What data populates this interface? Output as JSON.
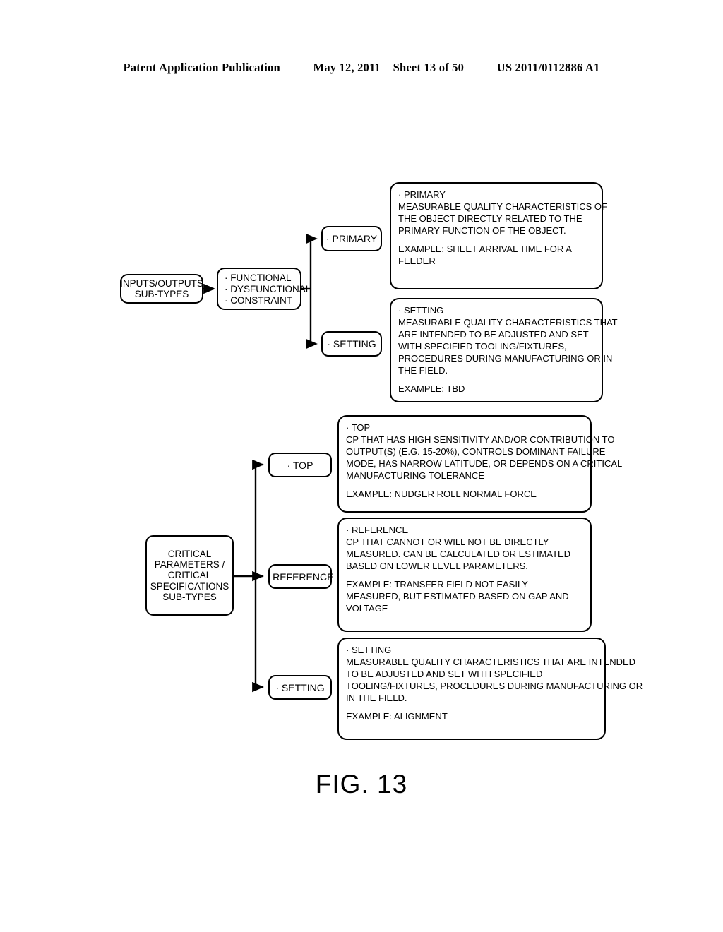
{
  "header": {
    "publication": "Patent Application Publication",
    "date": "May 12, 2011",
    "sheet": "Sheet 13 of 50",
    "number": "US 2011/0112886 A1"
  },
  "figure": {
    "caption": "FIG. 13",
    "ink_color": "#000000",
    "background_color": "#ffffff"
  },
  "diagram": {
    "branch_a": {
      "root_label": "INPUTS/OUTPUTS\nSUB-TYPES",
      "subtype_bullets": [
        "· FUNCTIONAL",
        "· DYSFUNCTIONAL",
        "· CONSTRAINT"
      ],
      "nodes": [
        {
          "pill": "· PRIMARY",
          "description": [
            "· PRIMARY",
            " MEASURABLE QUALITY CHARACTERISTICS OF",
            "THE OBJECT DIRECTLY RELATED TO THE",
            "PRIMARY FUNCTION OF THE OBJECT.",
            "",
            "EXAMPLE: SHEET ARRIVAL TIME FOR A",
            "FEEDER"
          ]
        },
        {
          "pill": "· SETTING",
          "description": [
            "· SETTING",
            "MEASURABLE QUALITY CHARACTERISTICS THAT",
            "ARE INTENDED TO BE ADJUSTED AND SET",
            "WITH SPECIFIED TOOLING/FIXTURES,",
            "PROCEDURES DURING MANUFACTURING OR IN",
            "THE FIELD.",
            "",
            "EXAMPLE: TBD"
          ]
        }
      ]
    },
    "branch_b": {
      "root_label": "CRITICAL\nPARAMETERS /\nCRITICAL\nSPECIFICATIONS\nSUB-TYPES",
      "nodes": [
        {
          "pill": "· TOP",
          "description": [
            "· TOP",
            "CP THAT HAS HIGH SENSITIVITY AND/OR CONTRIBUTION TO",
            "OUTPUT(S) (E.G. 15-20%), CONTROLS DOMINANT FAILURE",
            "MODE, HAS NARROW LATITUDE, OR DEPENDS ON A CRITICAL",
            "MANUFACTURING TOLERANCE",
            "",
            "EXAMPLE: NUDGER ROLL NORMAL FORCE"
          ]
        },
        {
          "pill": "· REFERENCE",
          "description": [
            "· REFERENCE",
            "CP THAT CANNOT OR WILL NOT BE DIRECTLY",
            "MEASURED. CAN BE CALCULATED OR ESTIMATED",
            "BASED ON LOWER LEVEL PARAMETERS.",
            "",
            "EXAMPLE: TRANSFER FIELD NOT EASILY",
            "MEASURED, BUT ESTIMATED BASED ON GAP AND",
            "VOLTAGE"
          ]
        },
        {
          "pill": "· SETTING",
          "description": [
            "· SETTING",
            "MEASURABLE QUALITY CHARACTERISTICS THAT ARE INTENDED",
            "TO BE ADJUSTED AND SET WITH SPECIFIED",
            "TOOLING/FIXTURES, PROCEDURES DURING MANUFACTURING OR",
            "IN THE FIELD.",
            "",
            "EXAMPLE: ALIGNMENT"
          ]
        }
      ]
    }
  }
}
